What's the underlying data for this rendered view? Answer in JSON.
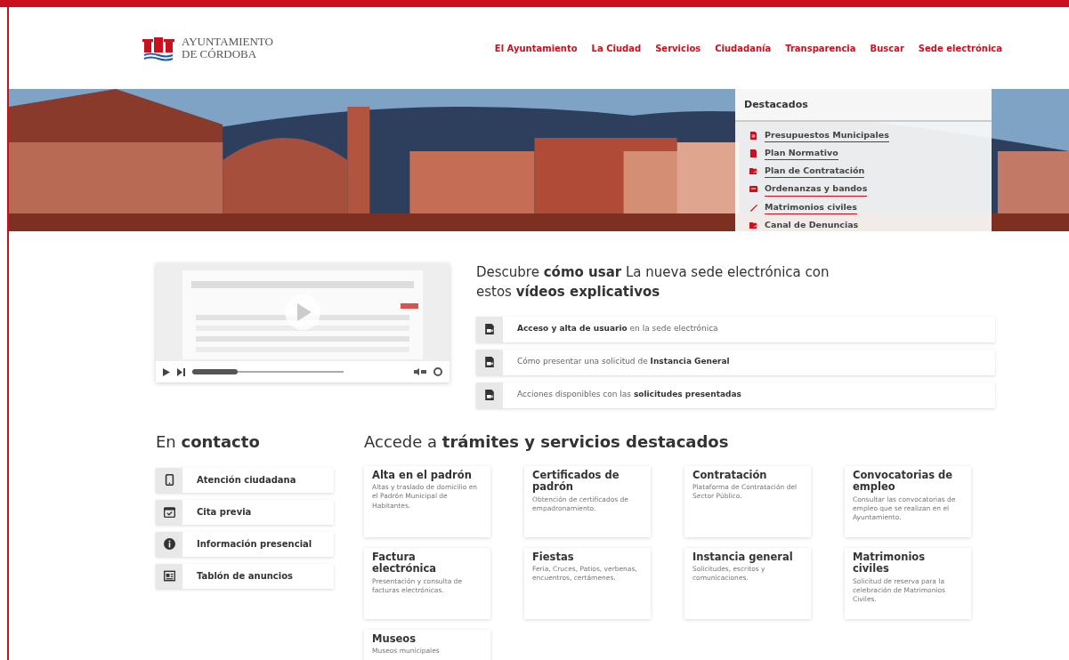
{
  "header": {
    "logo_line_1": "AYUNTAMIENTO",
    "logo_line_2": "DE CÓRDOBA",
    "nav": [
      {
        "label": "El Ayuntamiento"
      },
      {
        "label": "La Ciudad"
      },
      {
        "label": "Servicios"
      },
      {
        "label": "Ciudadanía"
      },
      {
        "label": "Transparencia"
      },
      {
        "label": "Buscar"
      },
      {
        "label": "Sede electrónica"
      }
    ]
  },
  "hero": {
    "panel": {
      "title": "Destacados",
      "links": [
        {
          "label": "Presupuestos Municipales"
        },
        {
          "label": "Plan Normativo"
        },
        {
          "label": "Plan de Contratación"
        },
        {
          "label": "Ordenanzas y bandos"
        },
        {
          "label": "Matrimonios civiles"
        },
        {
          "label": "Canal de Denuncias"
        }
      ]
    }
  },
  "videos": {
    "player": {
      "level": 0.3
    },
    "heading": "Descubre **cómo usar** La nueva sede electrónica con estos **vídeos explicativos**",
    "items": [
      {
        "label": "**Acceso y alta de usuario** en la sede electrónica"
      },
      {
        "label": "Cómo presentar una solicitud de **Instancia General**"
      },
      {
        "label": "Acciones disponibles con las **solicitudes presentadas**"
      }
    ]
  },
  "contact": {
    "heading": "En **contacto**",
    "items": [
      {
        "label": "Atención ciudadana"
      },
      {
        "label": "Cita previa"
      },
      {
        "label": "Información presencial"
      },
      {
        "label": "Tablón de anuncios"
      }
    ]
  },
  "services": {
    "heading": "Accede a **trámites y servicios destacados**",
    "cards": [
      {
        "title": "Alta en el padrón",
        "text": "Altas y traslado de domicilio en el Padrón Municipal de Habitantes."
      },
      {
        "title": "Certificados de padrón",
        "text": "Obtención de certificados de empadronamiento."
      },
      {
        "title": "Contratación",
        "text": "Plataforma de Contratación del Sector Público."
      },
      {
        "title": "Convocatorias de empleo",
        "text": "Consultar las convocatorias de empleo que se realizan en el Ayuntamiento."
      },
      {
        "title": "Factura electrónica",
        "text": "Presentación y consulta de facturas electrónicas."
      },
      {
        "title": "Fiestas",
        "text": "Feria, Cruces, Patios, verbenas, encuentros, certámenes."
      },
      {
        "title": "Instancia general",
        "text": "Solicitudes, escritos y comunicaciones."
      },
      {
        "title": "Matrimonios civiles",
        "text": "Solicitud de reserva para la celebración de Matrimonios Civiles."
      },
      {
        "title": "Museos",
        "text": "Museos municipales"
      }
    ]
  }
}
